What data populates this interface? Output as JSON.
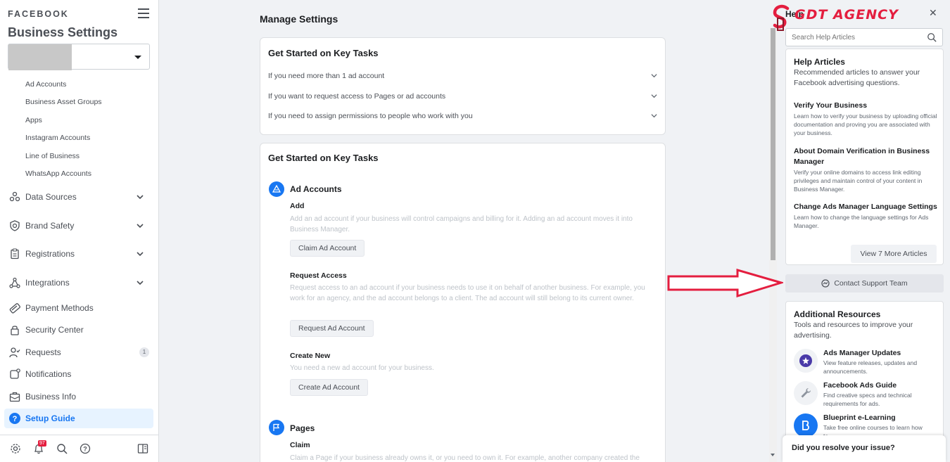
{
  "sidebar": {
    "brand": "FACEBOOK",
    "title": "Business Settings",
    "sub_items": [
      "Ad Accounts",
      "Business Asset Groups",
      "Apps",
      "Instagram Accounts",
      "Line of Business",
      "WhatsApp Accounts"
    ],
    "nav": [
      {
        "label": "Data Sources",
        "icon": "data-sources-icon"
      },
      {
        "label": "Brand Safety",
        "icon": "shield-icon"
      },
      {
        "label": "Registrations",
        "icon": "clipboard-icon"
      },
      {
        "label": "Integrations",
        "icon": "integrations-icon"
      },
      {
        "label": "Payment Methods",
        "icon": "payment-icon"
      },
      {
        "label": "Security Center",
        "icon": "lock-icon"
      },
      {
        "label": "Requests",
        "icon": "person-check-icon",
        "badge": "1"
      },
      {
        "label": "Notifications",
        "icon": "notification-icon"
      },
      {
        "label": "Business Info",
        "icon": "briefcase-icon"
      },
      {
        "label": "Setup Guide",
        "icon": "question-icon"
      }
    ],
    "notif_count": "97"
  },
  "main": {
    "title": "Manage Settings",
    "card1": {
      "title": "Get Started on Key Tasks",
      "rows": [
        "If you need more than 1 ad account",
        "If you want to request access to Pages or ad accounts",
        "If you need to assign permissions to people who work with you"
      ]
    },
    "card2": {
      "title": "Get Started on Key Tasks",
      "ad_accounts": {
        "title": "Ad Accounts",
        "add_title": "Add",
        "add_desc": "Add an ad account if your business will control campaigns and billing for it. Adding an ad account moves it into Business Manager.",
        "claim_btn": "Claim Ad Account",
        "request_title": "Request Access",
        "request_desc": "Request access to an ad account if your business needs to use it on behalf of another business. For example, you work for an agency, and the ad account belongs to a client. The ad account will still belong to its current owner.",
        "request_btn": "Request Ad Account",
        "create_title": "Create New",
        "create_desc": "You need a new ad account for your business.",
        "create_btn": "Create Ad Account"
      },
      "pages": {
        "title": "Pages",
        "claim_title": "Claim",
        "claim_desc": "Claim a Page if your business already owns it, or you need to own it. For example, another company created the"
      }
    }
  },
  "help": {
    "title": "Help",
    "logo_text": "GDT AGENCY",
    "search_placeholder": "Search Help Articles",
    "articles": {
      "title": "Help Articles",
      "subtitle": "Recommended articles to answer your Facebook advertising questions.",
      "items": [
        {
          "title": "Verify Your Business",
          "desc": "Learn how to verify your business by uploading official documentation and proving you are associated with your business."
        },
        {
          "title": "About Domain Verification in Business Manager",
          "desc": "Verify your online domains to access link editing privileges and maintain control of your content in Business Manager."
        },
        {
          "title": "Change Ads Manager Language Settings",
          "desc": "Learn how to change the language settings for Ads Manager."
        }
      ],
      "more_btn": "View 7 More Articles"
    },
    "contact_btn": "Contact Support Team",
    "resources": {
      "title": "Additional Resources",
      "subtitle": "Tools and resources to improve your advertising.",
      "items": [
        {
          "title": "Ads Manager Updates",
          "desc": "View feature releases, updates and announcements."
        },
        {
          "title": "Facebook Ads Guide",
          "desc": "Find creative specs and technical requirements for ads."
        },
        {
          "title": "Blueprint e-Learning",
          "desc": "Take free online courses to learn how to"
        }
      ]
    },
    "resolve": "Did you resolve your issue?"
  }
}
